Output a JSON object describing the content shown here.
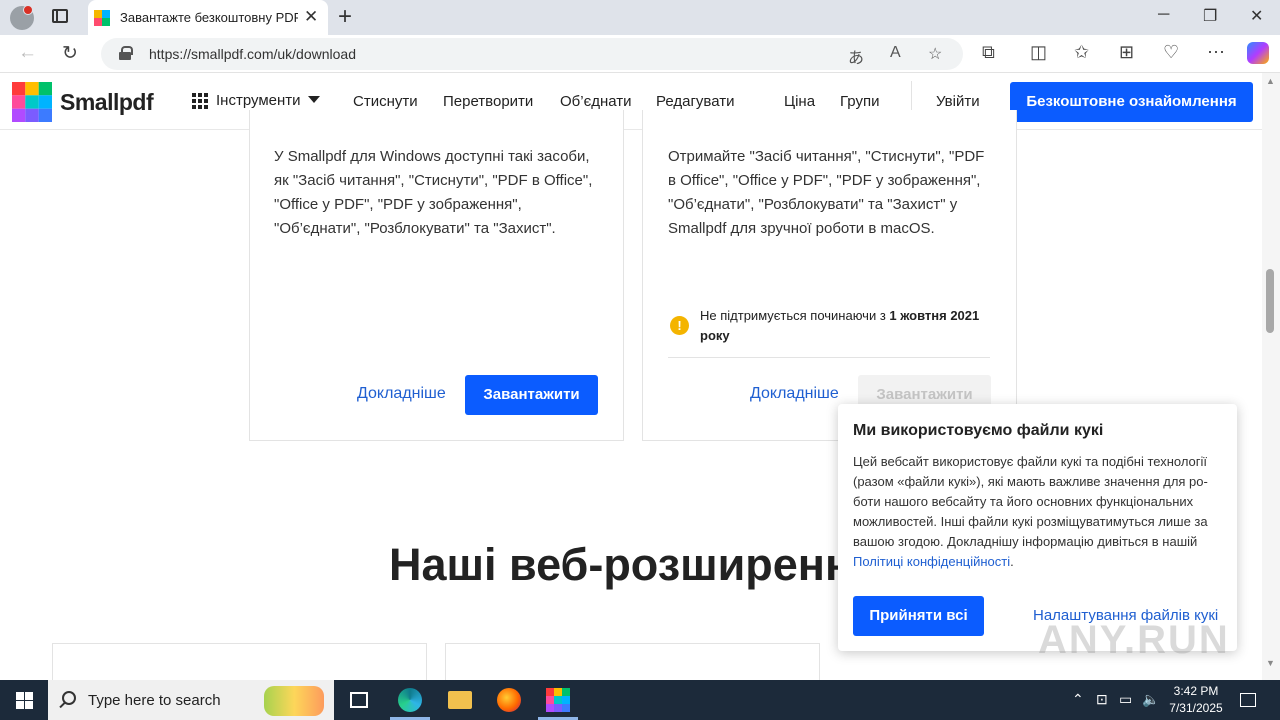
{
  "browser": {
    "tab_title": "Завантажте безкоштовну PDF-пр",
    "url": "https://smallpdf.com/uk/download",
    "colors": {
      "chrome": "#dfe3ea",
      "accent": "#0b5cff"
    }
  },
  "header": {
    "logo_text": "Smallpdf",
    "tools_label": "Інструменти",
    "nav": [
      "Стиснути",
      "Перетворити",
      "Об’єднати",
      "Редагувати",
      "Ціна",
      "Групи"
    ],
    "login": "Увійти",
    "trial_button": "Безкоштовне ознайомлення"
  },
  "cards": {
    "windows": {
      "description": "У Smallpdf для Windows доступні такі засоби, як \"Засіб читання\", \"Стиснути\", \"PDF в Office\", \"Office у PDF\", \"PDF у зображення\", \"Об’єднати\", \"Розблокувати\" та \"Захист\".",
      "more_link": "Докладніше",
      "download_button": "Завантажити"
    },
    "mac": {
      "description": "Отримайте \"Засіб читання\", \"Стиснути\", \"PDF в Office\", \"Office у PDF\", \"PDF у зображення\", \"Об’єднати\", \"Розблокувати\" та \"Захист\" у Smallpdf для зручної роботи в macOS.",
      "warning_prefix": "Не підтримується починаючи з ",
      "warning_date": "1 жовтня 2021 року",
      "more_link": "Докладніше",
      "download_button": "Завантажити"
    }
  },
  "section_title": "Наші веб-розширення",
  "cookie": {
    "title": "Ми використовуємо файли кукі",
    "body": "Цей вебсайт використовує файли кукі та подібні технології (разом «файли кукі»), які мають важливе значення для ро­боти нашого вебсайту та його основних функціональних можливостей. Інші файли кукі розміщуватимуться лише за вашою згодою. Докладнішу інформацію дивіться в нашій ",
    "policy_link": "Політиці конфіденційності",
    "period": ".",
    "accept_button": "Прийняти всі",
    "settings_link": "Налаштування файлів кукі"
  },
  "watermark": "ANY.RUN",
  "taskbar": {
    "search_placeholder": "Type here to search",
    "time": "3:42 PM",
    "date": "7/31/2025"
  }
}
